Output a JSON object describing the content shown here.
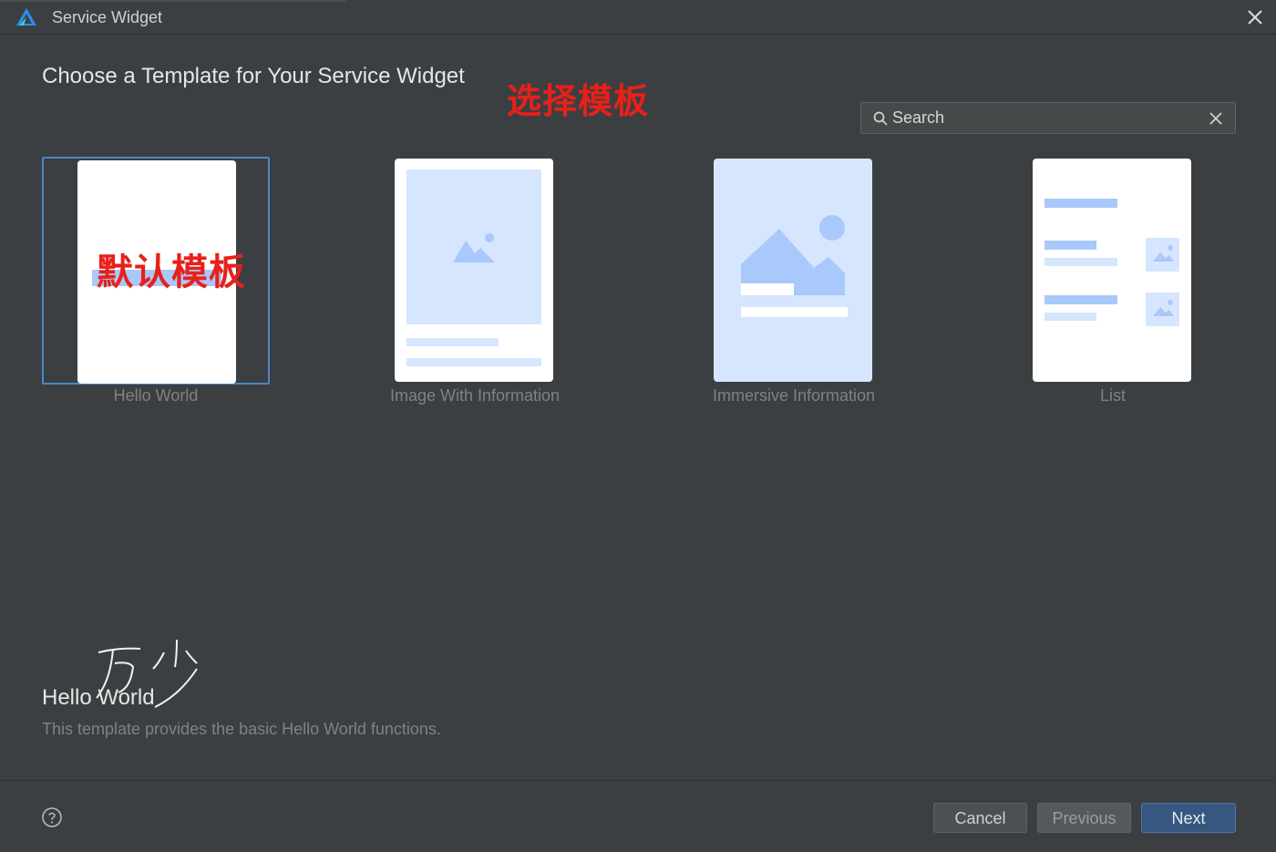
{
  "window": {
    "title": "Service Widget"
  },
  "header": {
    "heading": "Choose a Template for Your Service Widget",
    "annotation": "选择模板"
  },
  "search": {
    "placeholder": "Search"
  },
  "templates": [
    {
      "label": "Hello World",
      "selected": true,
      "annotation": "默认模板"
    },
    {
      "label": "Image With Information",
      "selected": false
    },
    {
      "label": "Immersive Information",
      "selected": false
    },
    {
      "label": "List",
      "selected": false
    }
  ],
  "detail": {
    "title": "Hello World",
    "description": "This template provides the basic Hello World functions.",
    "handwritten_note": "万 少"
  },
  "footer": {
    "cancel_label": "Cancel",
    "previous_label": "Previous",
    "next_label": "Next"
  },
  "colors": {
    "background": "#3c3f41",
    "selection_border": "#4a88c7",
    "placeholder_fill": "#d6e6ff",
    "placeholder_shape": "#a9c8fb",
    "annotation_red": "#e8201a",
    "primary_button": "#365880"
  },
  "icons": {
    "logo": "app-logo-icon",
    "close": "close-icon",
    "search": "search-icon",
    "clear": "clear-icon",
    "help": "help-icon"
  }
}
